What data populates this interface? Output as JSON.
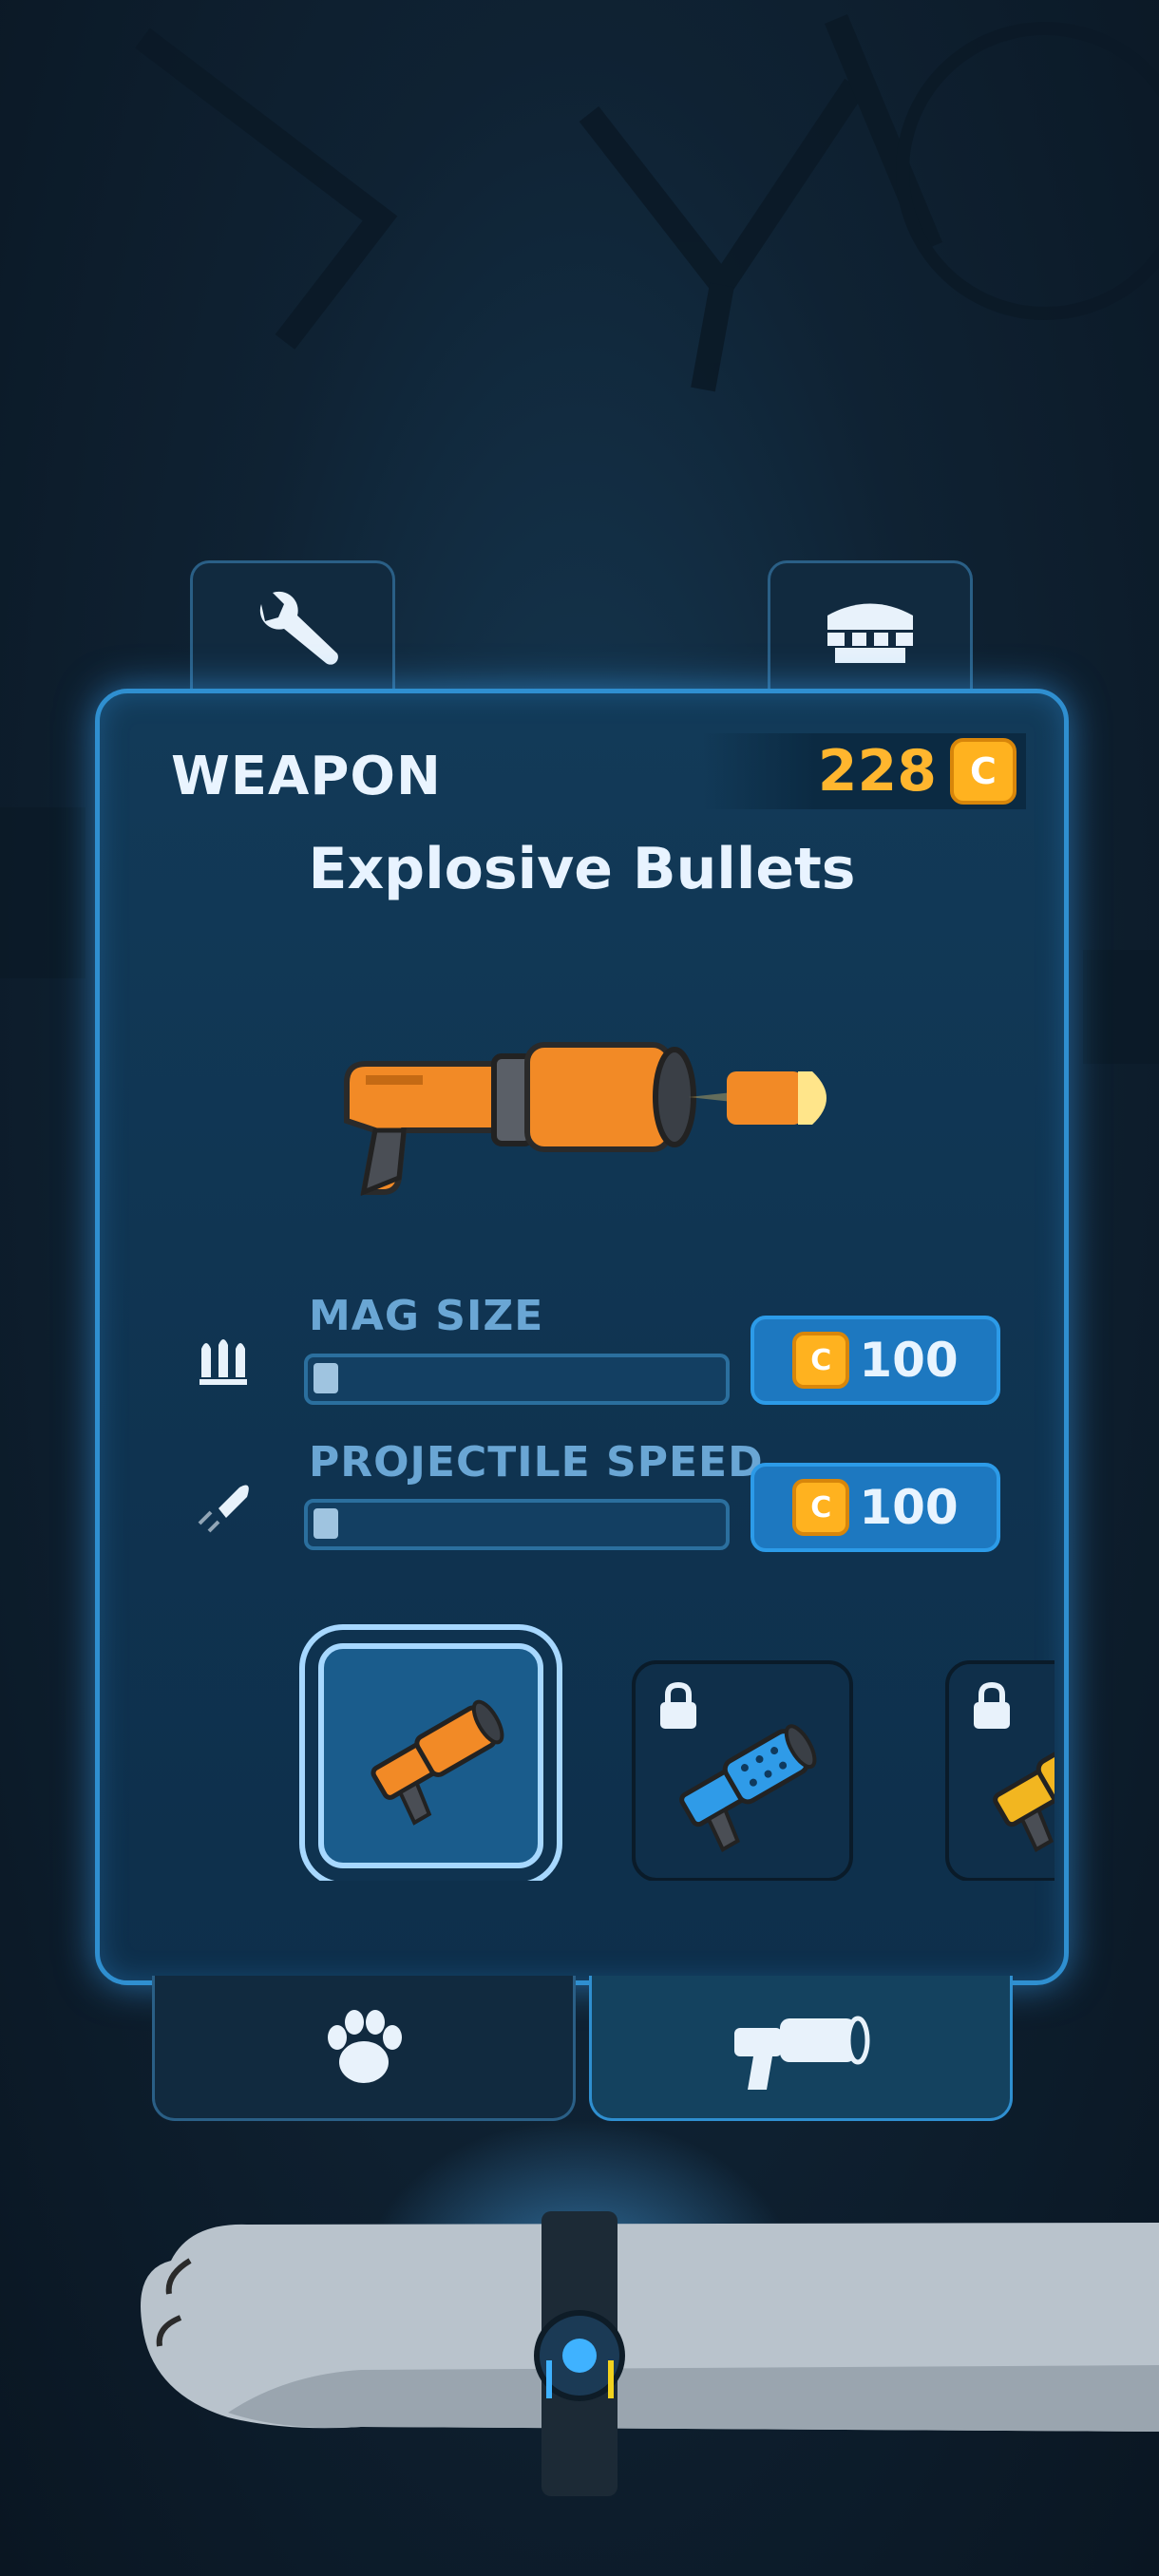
{
  "header": {
    "section_label": "WEAPON",
    "coins": "228",
    "coin_symbol": "C"
  },
  "weapon": {
    "name": "Explosive Bullets"
  },
  "stats": [
    {
      "label": "MAG SIZE",
      "level": 0.06,
      "price": "100",
      "icon": "bullets-icon"
    },
    {
      "label": "PROJECTILE SPEED",
      "level": 0.06,
      "price": "100",
      "icon": "projectile-icon"
    }
  ],
  "weapon_slots": [
    {
      "name": "orange-blaster",
      "selected": true,
      "locked": false,
      "color": "#f28a26"
    },
    {
      "name": "blue-blaster",
      "selected": false,
      "locked": true,
      "color": "#2f9be8"
    },
    {
      "name": "yellow-blaster",
      "selected": false,
      "locked": true,
      "color": "#f2b620"
    }
  ],
  "tabs": {
    "top": [
      "wrench-icon",
      "shop-icon"
    ],
    "bottom": [
      "paw-icon",
      "gun-icon"
    ],
    "active_bottom": "gun-icon"
  },
  "colors": {
    "panel_border": "#2f8fd0",
    "coin": "#ffb21f",
    "button": "#1d78c0"
  }
}
